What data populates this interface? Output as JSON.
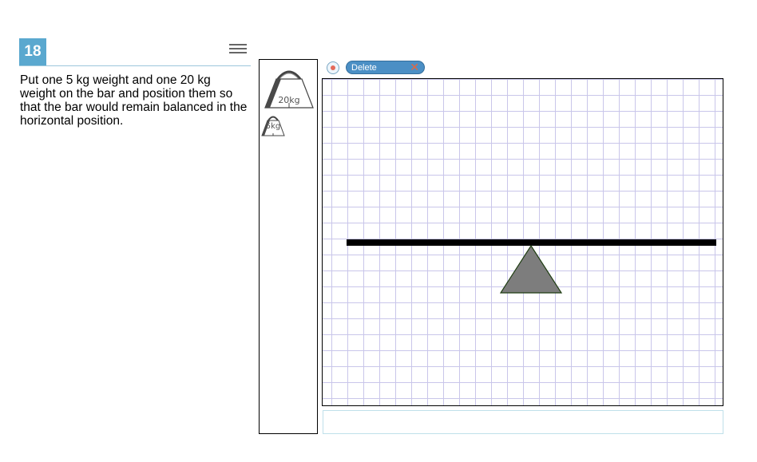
{
  "question": {
    "number": "18",
    "text": "Put one 5 kg weight and one 20 kg weight on the bar and position them so that the bar would remain balanced in the horizontal position."
  },
  "palette": {
    "weights": [
      {
        "label": "20kg",
        "icon": "weight-icon"
      },
      {
        "label": "5kg",
        "icon": "weight-icon"
      }
    ]
  },
  "toolbar": {
    "delete_label": "Delete",
    "delete_icon": "x-icon",
    "reset_icon": "reset-icon"
  },
  "colors": {
    "accent": "#5aa8cf",
    "button": "#4b8fc5",
    "grid": "#c9c6ea",
    "fulcrum": "#7d7d7d"
  }
}
